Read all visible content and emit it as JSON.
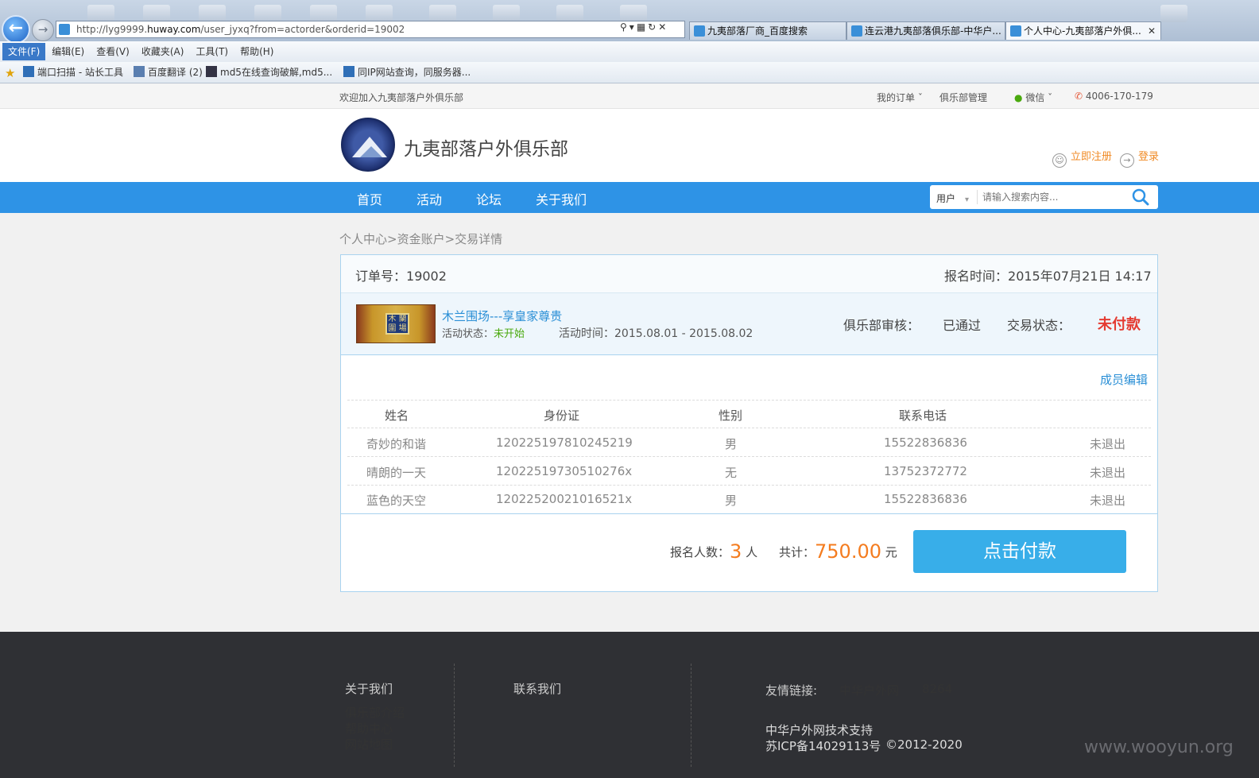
{
  "browser": {
    "url_prefix": "http://lyg9999.",
    "url_host": "huway.com",
    "url_path": "/user_jyxq?from=actorder&orderid=19002",
    "tabs": [
      {
        "label": "九夷部落厂商_百度搜索"
      },
      {
        "label": "连云港九夷部落俱乐部-中华户..."
      },
      {
        "label": "个人中心-九夷部落户外俱..."
      }
    ],
    "menu": [
      "文件(F)",
      "编辑(E)",
      "查看(V)",
      "收藏夹(A)",
      "工具(T)",
      "帮助(H)"
    ],
    "favorites": [
      "端口扫描 - 站长工具",
      "百度翻译 (2)",
      "md5在线查询破解,md5...",
      "同IP网站查询，同服务器..."
    ]
  },
  "topbar": {
    "welcome": "欢迎加入九夷部落户外俱乐部",
    "my_orders": "我的订单",
    "club_manage": "俱乐部管理",
    "wechat": "微信",
    "phone": "4006-170-179"
  },
  "header": {
    "site_name": "九夷部落户外俱乐部",
    "register": "立即注册",
    "login": "登录"
  },
  "nav": {
    "items": [
      "首页",
      "活动",
      "论坛",
      "关于我们"
    ],
    "search_scope": "用户",
    "search_placeholder": "请输入搜索内容..."
  },
  "breadcrumb": "个人中心>资金账户>交易详情",
  "order": {
    "number_label": "订单号：",
    "number": "19002",
    "signup_time_label": "报名时间：",
    "signup_time": "2015年07月21日 14:17",
    "activity_title": "木兰围场---享皇家尊贵",
    "activity_status_label": "活动状态：",
    "activity_status": "未开始",
    "activity_time_label": "活动时间：",
    "activity_time": "2015.08.01 - 2015.08.02",
    "club_review_label": "俱乐部审核：",
    "club_review": "已通过",
    "trade_status_label": "交易状态：",
    "trade_status": "未付款",
    "member_edit": "成员编辑"
  },
  "members": {
    "headers": [
      "姓名",
      "身份证",
      "性别",
      "联系电话"
    ],
    "rows": [
      {
        "name": "奇妙的和谐",
        "id": "120225197810245219",
        "gender": "男",
        "phone": "15522836836",
        "status": "未退出"
      },
      {
        "name": "晴朗的一天",
        "id": "12022519730510276x",
        "gender": "无",
        "phone": "13752372772",
        "status": "未退出"
      },
      {
        "name": "蓝色的天空",
        "id": "12022520021016521x",
        "gender": "男",
        "phone": "15522836836",
        "status": "未退出"
      }
    ]
  },
  "summary": {
    "count_label": "报名人数：",
    "count": "3",
    "count_unit": "人",
    "total_label": "共计：",
    "total": "750.00",
    "total_unit": "元",
    "pay_button": "点击付款"
  },
  "footer": {
    "about_title": "关于我们",
    "about_links": [
      "俱乐部介绍",
      "帮助中心",
      "网站地图"
    ],
    "contact_title": "联系我们",
    "friend_links_label": "友情链接:",
    "friend_links": [
      "中华户外网",
      "8264"
    ],
    "tech_support": "中华户外网技术支持",
    "icp": "苏ICP备14029113号",
    "copyright": "©2012-2020"
  },
  "watermark": "www.wooyun.org",
  "colors": {
    "nav_blue": "#2e93e6",
    "pay_button": "#38aee9",
    "price_orange": "#f47c1f",
    "status_red": "#e43b32",
    "status_green": "#4aa90e",
    "link_blue": "#2a8fd6",
    "footer_bg": "#2f3034"
  }
}
